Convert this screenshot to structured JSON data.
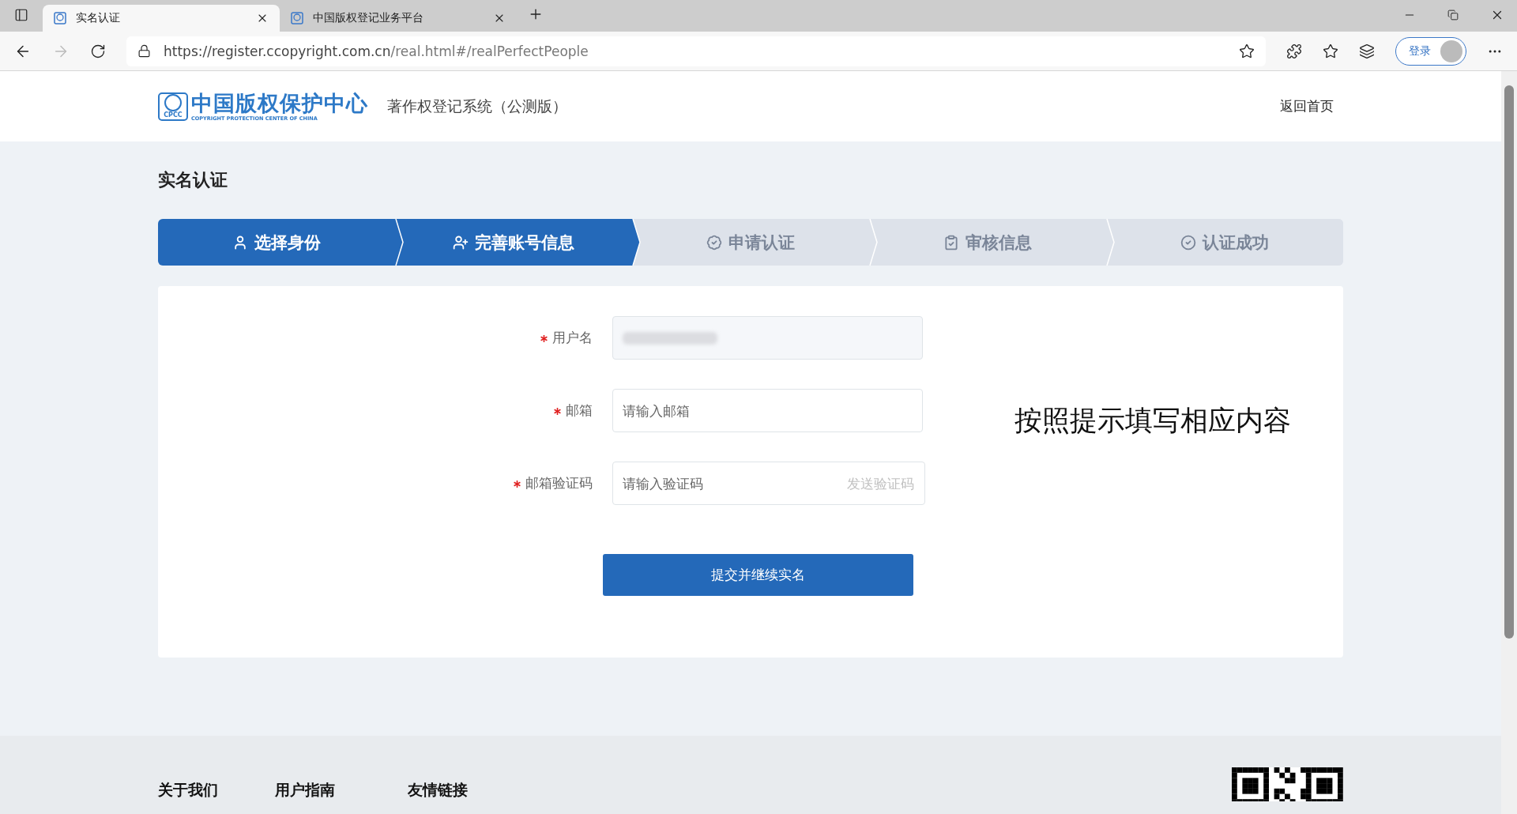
{
  "browser": {
    "tabs": [
      {
        "title": "实名认证",
        "selected": true
      },
      {
        "title": "中国版权登记业务平台",
        "selected": false
      }
    ],
    "url": {
      "host": "https://register.ccopyright.com.cn",
      "path": "/real.html#/realPerfectPeople"
    },
    "sign_in": "登录"
  },
  "header": {
    "logo": {
      "badge": "CPCC",
      "name": "中国版权保护中心",
      "english": "COPYRIGHT PROTECTION CENTER OF CHINA"
    },
    "system_title": "著作权登记系统（公测版）",
    "home_link": "返回首页"
  },
  "page_title": "实名认证",
  "steps": [
    {
      "label": "选择身份",
      "completed": true
    },
    {
      "label": "完善账号信息",
      "completed": true
    },
    {
      "label": "申请认证",
      "completed": false
    },
    {
      "label": "审核信息",
      "completed": false
    },
    {
      "label": "认证成功",
      "completed": false
    }
  ],
  "form": {
    "fields": [
      {
        "label": "用户名",
        "required": true,
        "disabled": true,
        "redacted": true
      },
      {
        "label": "邮箱",
        "required": true,
        "disabled": false,
        "placeholder": "请输入邮箱"
      },
      {
        "label": "邮箱验证码",
        "required": true,
        "disabled": false,
        "placeholder": "请输入验证码",
        "action": "发送验证码"
      }
    ],
    "submit": "提交并继续实名"
  },
  "annotation": "按照提示填写相应内容",
  "footer": {
    "links": [
      "关于我们",
      "用户指南",
      "友情链接"
    ]
  }
}
